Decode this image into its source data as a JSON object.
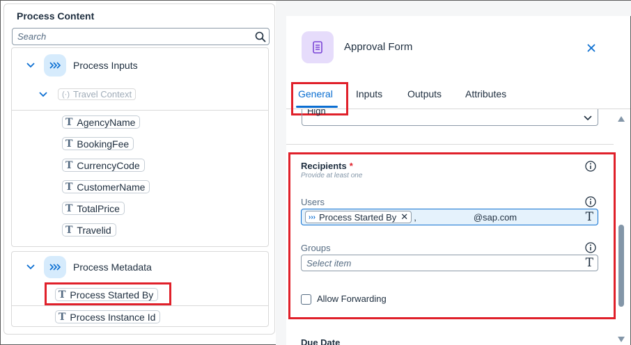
{
  "left_panel": {
    "title": "Process Content",
    "search_placeholder": "Search",
    "process_inputs": {
      "label": "Process Inputs",
      "context_label": "Travel Context",
      "fields": [
        "AgencyName",
        "BookingFee",
        "CurrencyCode",
        "CustomerName",
        "TotalPrice",
        "Travelid"
      ]
    },
    "process_metadata": {
      "label": "Process Metadata",
      "fields": [
        "Process Started By",
        "Process Instance Id"
      ]
    }
  },
  "form": {
    "title": "Approval Form",
    "tabs": [
      {
        "label": "General",
        "active": true
      },
      {
        "label": "Inputs",
        "active": false
      },
      {
        "label": "Outputs",
        "active": false
      },
      {
        "label": "Attributes",
        "active": false
      }
    ],
    "priority_value": "High",
    "recipients": {
      "title": "Recipients",
      "required_mark": "*",
      "hint": "Provide at least one",
      "users_label": "Users",
      "users_token": "Process Started By",
      "users_separator": ",",
      "users_email": "@sap.com",
      "groups_label": "Groups",
      "groups_placeholder": "Select item",
      "allow_forwarding_label": "Allow Forwarding",
      "allow_forwarding_checked": false
    },
    "due_date_label": "Due Date"
  },
  "colors": {
    "accent": "#0a6ed1",
    "highlight_box": "#e0202a",
    "process_icon_bg": "#d6ebfc",
    "form_icon_bg": "#e6dcfb"
  },
  "icons": {
    "search": "search-icon",
    "process": "process-double-chevron-icon",
    "text_type": "text-type-icon",
    "form": "form-document-icon",
    "close": "close-icon",
    "info": "info-icon"
  }
}
